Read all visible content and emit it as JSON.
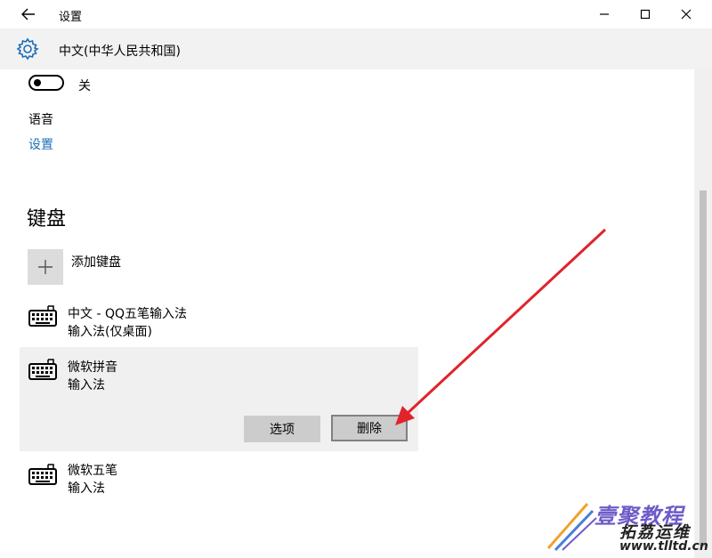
{
  "titlebar": {
    "title": "设置",
    "back_icon": "back-arrow-icon",
    "minimize_icon": "minimize-icon",
    "maximize_icon": "maximize-icon",
    "close_icon": "close-icon"
  },
  "header": {
    "icon": "gear-icon",
    "title": "中文(中华人民共和国)"
  },
  "toggle": {
    "state": "off",
    "label": "关"
  },
  "speech": {
    "title": "语音",
    "link": "设置"
  },
  "keyboard": {
    "title": "键盘",
    "add_label": "添加键盘",
    "items": [
      {
        "name": "中文 - QQ五笔输入法",
        "sub": "输入法(仅桌面)",
        "icon": "keyboard-icon"
      },
      {
        "name": "微软拼音",
        "sub": "输入法",
        "icon": "keyboard-icon",
        "expanded": true
      },
      {
        "name": "微软五笔",
        "sub": "输入法",
        "icon": "keyboard-icon"
      }
    ],
    "options_label": "选项",
    "delete_label": "删除"
  },
  "colors": {
    "accent_link": "#1a6fb8",
    "header_bg": "#f2f2f2",
    "arrow": "#e0242b"
  },
  "watermark": {
    "line1": "壹聚教程",
    "line2": "拓荔运维",
    "line3": "www.tlltd.cn"
  }
}
